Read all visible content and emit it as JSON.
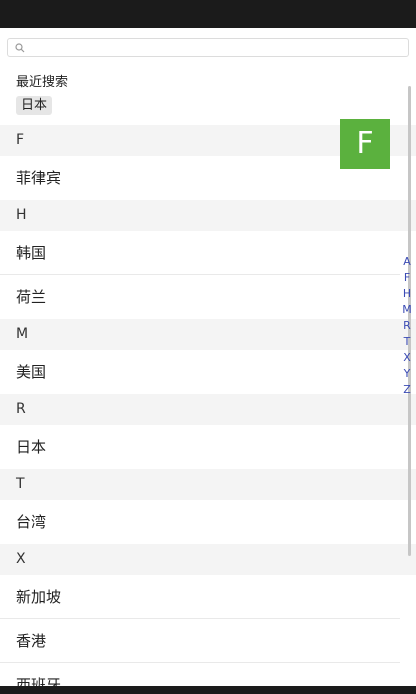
{
  "search": {
    "placeholder": ""
  },
  "recent": {
    "title": "最近搜索",
    "tags": [
      "日本"
    ]
  },
  "list": [
    {
      "type": "header",
      "label": "F"
    },
    {
      "type": "row",
      "label": "菲律宾"
    },
    {
      "type": "header",
      "label": "H"
    },
    {
      "type": "row",
      "label": "韩国"
    },
    {
      "type": "row",
      "label": "荷兰"
    },
    {
      "type": "header",
      "label": "M"
    },
    {
      "type": "row",
      "label": "美国"
    },
    {
      "type": "header",
      "label": "R"
    },
    {
      "type": "row",
      "label": "日本"
    },
    {
      "type": "header",
      "label": "T"
    },
    {
      "type": "row",
      "label": "台湾"
    },
    {
      "type": "header",
      "label": "X"
    },
    {
      "type": "row",
      "label": "新加坡"
    },
    {
      "type": "row",
      "label": "香港"
    },
    {
      "type": "row",
      "label": "西班牙"
    }
  ],
  "popup_letter": "F",
  "index_letters": [
    "A",
    "F",
    "H",
    "M",
    "R",
    "T",
    "X",
    "Y",
    "Z"
  ],
  "colors": {
    "accent": "#5bb13e",
    "index_letter": "#3b4bb4",
    "header_bg": "#f4f4f4"
  }
}
